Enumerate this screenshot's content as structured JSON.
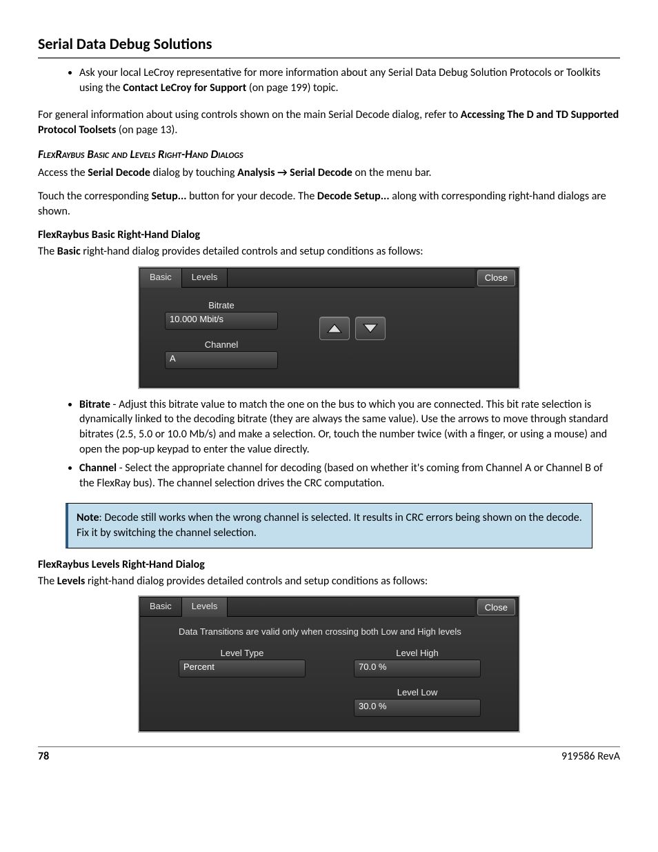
{
  "header": {
    "title": "Serial Data Debug Solutions"
  },
  "intro_bullet": {
    "prefix": "Ask your local LeCroy representative for more information about any Serial Data Debug Solution Protocols or Toolkits using the ",
    "bold": "Contact LeCroy for Support",
    "suffix": " (on page 199) topic."
  },
  "general_info": {
    "prefix": "For general information about using controls shown on the main Serial Decode dialog, refer to ",
    "bold": "Accessing The D and TD Supported Protocol Toolsets",
    "suffix": " (on page 13)."
  },
  "section1": {
    "heading": "FlexRaybus Basic and Levels Right-Hand Dialogs",
    "p1a": "Access the ",
    "p1b": "Serial Decode",
    "p1c": " dialog by touching ",
    "p1d": "Analysis → Serial Decode",
    "p1e": " on the menu bar.",
    "p2a": "Touch the corresponding ",
    "p2b": "Setup...",
    "p2c": " button for your decode. The ",
    "p2d": "Decode Setup...",
    "p2e": " along with corresponding right-hand dialogs are shown."
  },
  "basic_dialog_section": {
    "heading": "FlexRaybus Basic Right-Hand Dialog",
    "intro_a": "The ",
    "intro_b": "Basic",
    "intro_c": " right-hand dialog provides detailed controls and setup conditions as follows:"
  },
  "dialog1": {
    "tabs": {
      "basic": "Basic",
      "levels": "Levels"
    },
    "close": "Close",
    "bitrate_label": "Bitrate",
    "bitrate_value": "10.000 Mbit/s",
    "channel_label": "Channel",
    "channel_value": "A"
  },
  "controls_bullets": {
    "bitrate": {
      "label": "Bitrate",
      "text": " - Adjust this bitrate value to match the one on the bus to which you are connected. This bit rate selection is dynamically linked to the decoding bitrate (they are always the same value). Use the arrows to move through standard bitrates (2.5, 5.0 or 10.0 Mb/s) and make a selection. Or, touch the number twice (with a finger, or using a mouse) and open the pop-up keypad to enter the value directly."
    },
    "channel": {
      "label": "Channel",
      "text": " - Select the appropriate channel for decoding (based on whether it's coming from Channel A or Channel B of the FlexRay bus). The channel selection drives the CRC computation."
    }
  },
  "note_box": {
    "label": "Note",
    "text": ": Decode still works when the wrong channel is selected. It results in CRC errors being shown on the decode. Fix it by switching the channel selection."
  },
  "levels_dialog_section": {
    "heading": "FlexRaybus Levels Right-Hand Dialog",
    "intro_a": "The ",
    "intro_b": "Levels",
    "intro_c": " right-hand dialog provides detailed controls and setup conditions as follows:"
  },
  "dialog2": {
    "tabs": {
      "basic": "Basic",
      "levels": "Levels"
    },
    "close": "Close",
    "note": "Data Transitions are valid only when crossing both Low and High levels",
    "level_type_label": "Level Type",
    "level_type_value": "Percent",
    "level_high_label": "Level High",
    "level_high_value": "70.0 %",
    "level_low_label": "Level Low",
    "level_low_value": "30.0 %"
  },
  "footer": {
    "page": "78",
    "doc": "919586 RevA"
  }
}
